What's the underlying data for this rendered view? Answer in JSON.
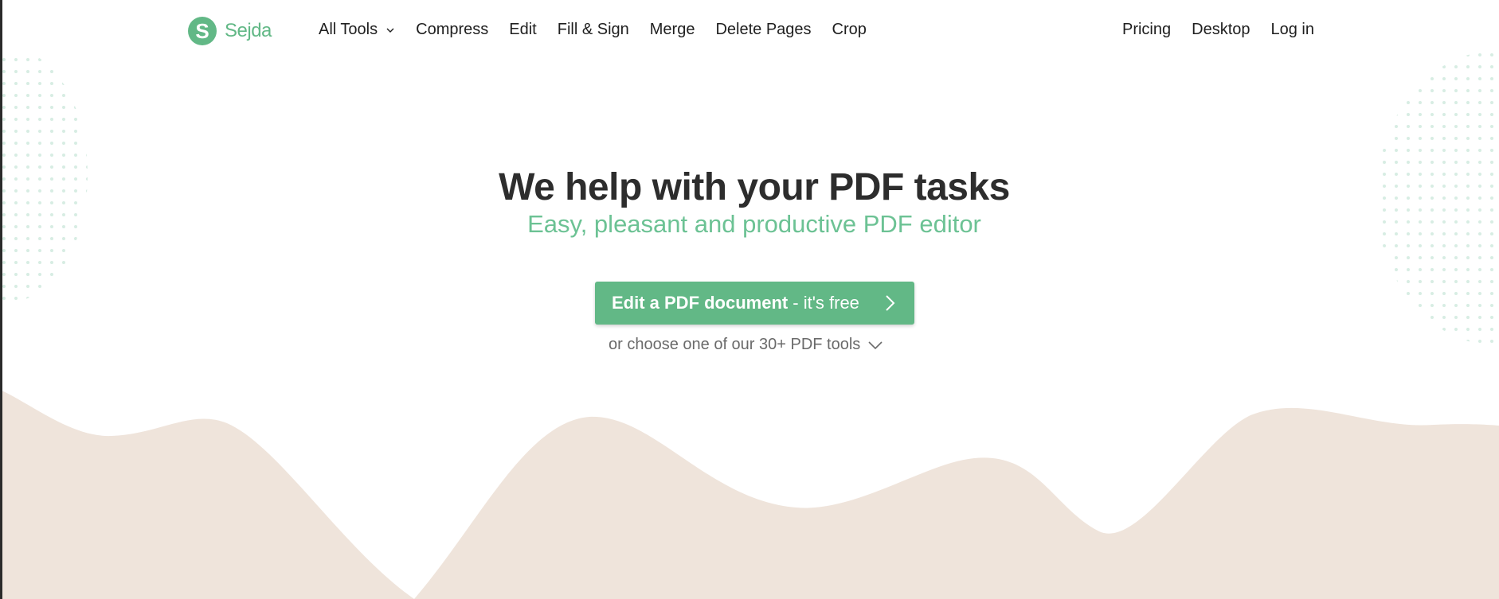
{
  "brand": {
    "logo_letter": "S",
    "name": "Sejda",
    "color": "#62b886"
  },
  "nav": {
    "left": [
      {
        "label": "All Tools",
        "has_dropdown": true
      },
      {
        "label": "Compress"
      },
      {
        "label": "Edit"
      },
      {
        "label": "Fill & Sign"
      },
      {
        "label": "Merge"
      },
      {
        "label": "Delete Pages"
      },
      {
        "label": "Crop"
      }
    ],
    "right": [
      {
        "label": "Pricing"
      },
      {
        "label": "Desktop"
      },
      {
        "label": "Log in"
      }
    ]
  },
  "hero": {
    "title": "We help with your PDF tasks",
    "subtitle": "Easy, pleasant and productive PDF editor",
    "cta_bold": "Edit a PDF document",
    "cta_light": "- it's free",
    "more_tools": "or choose one of our 30+ PDF tools"
  },
  "colors": {
    "accent": "#62b886",
    "subtitle": "#6cc294",
    "wave": "#efe4db",
    "dots": "#d7ede3"
  }
}
